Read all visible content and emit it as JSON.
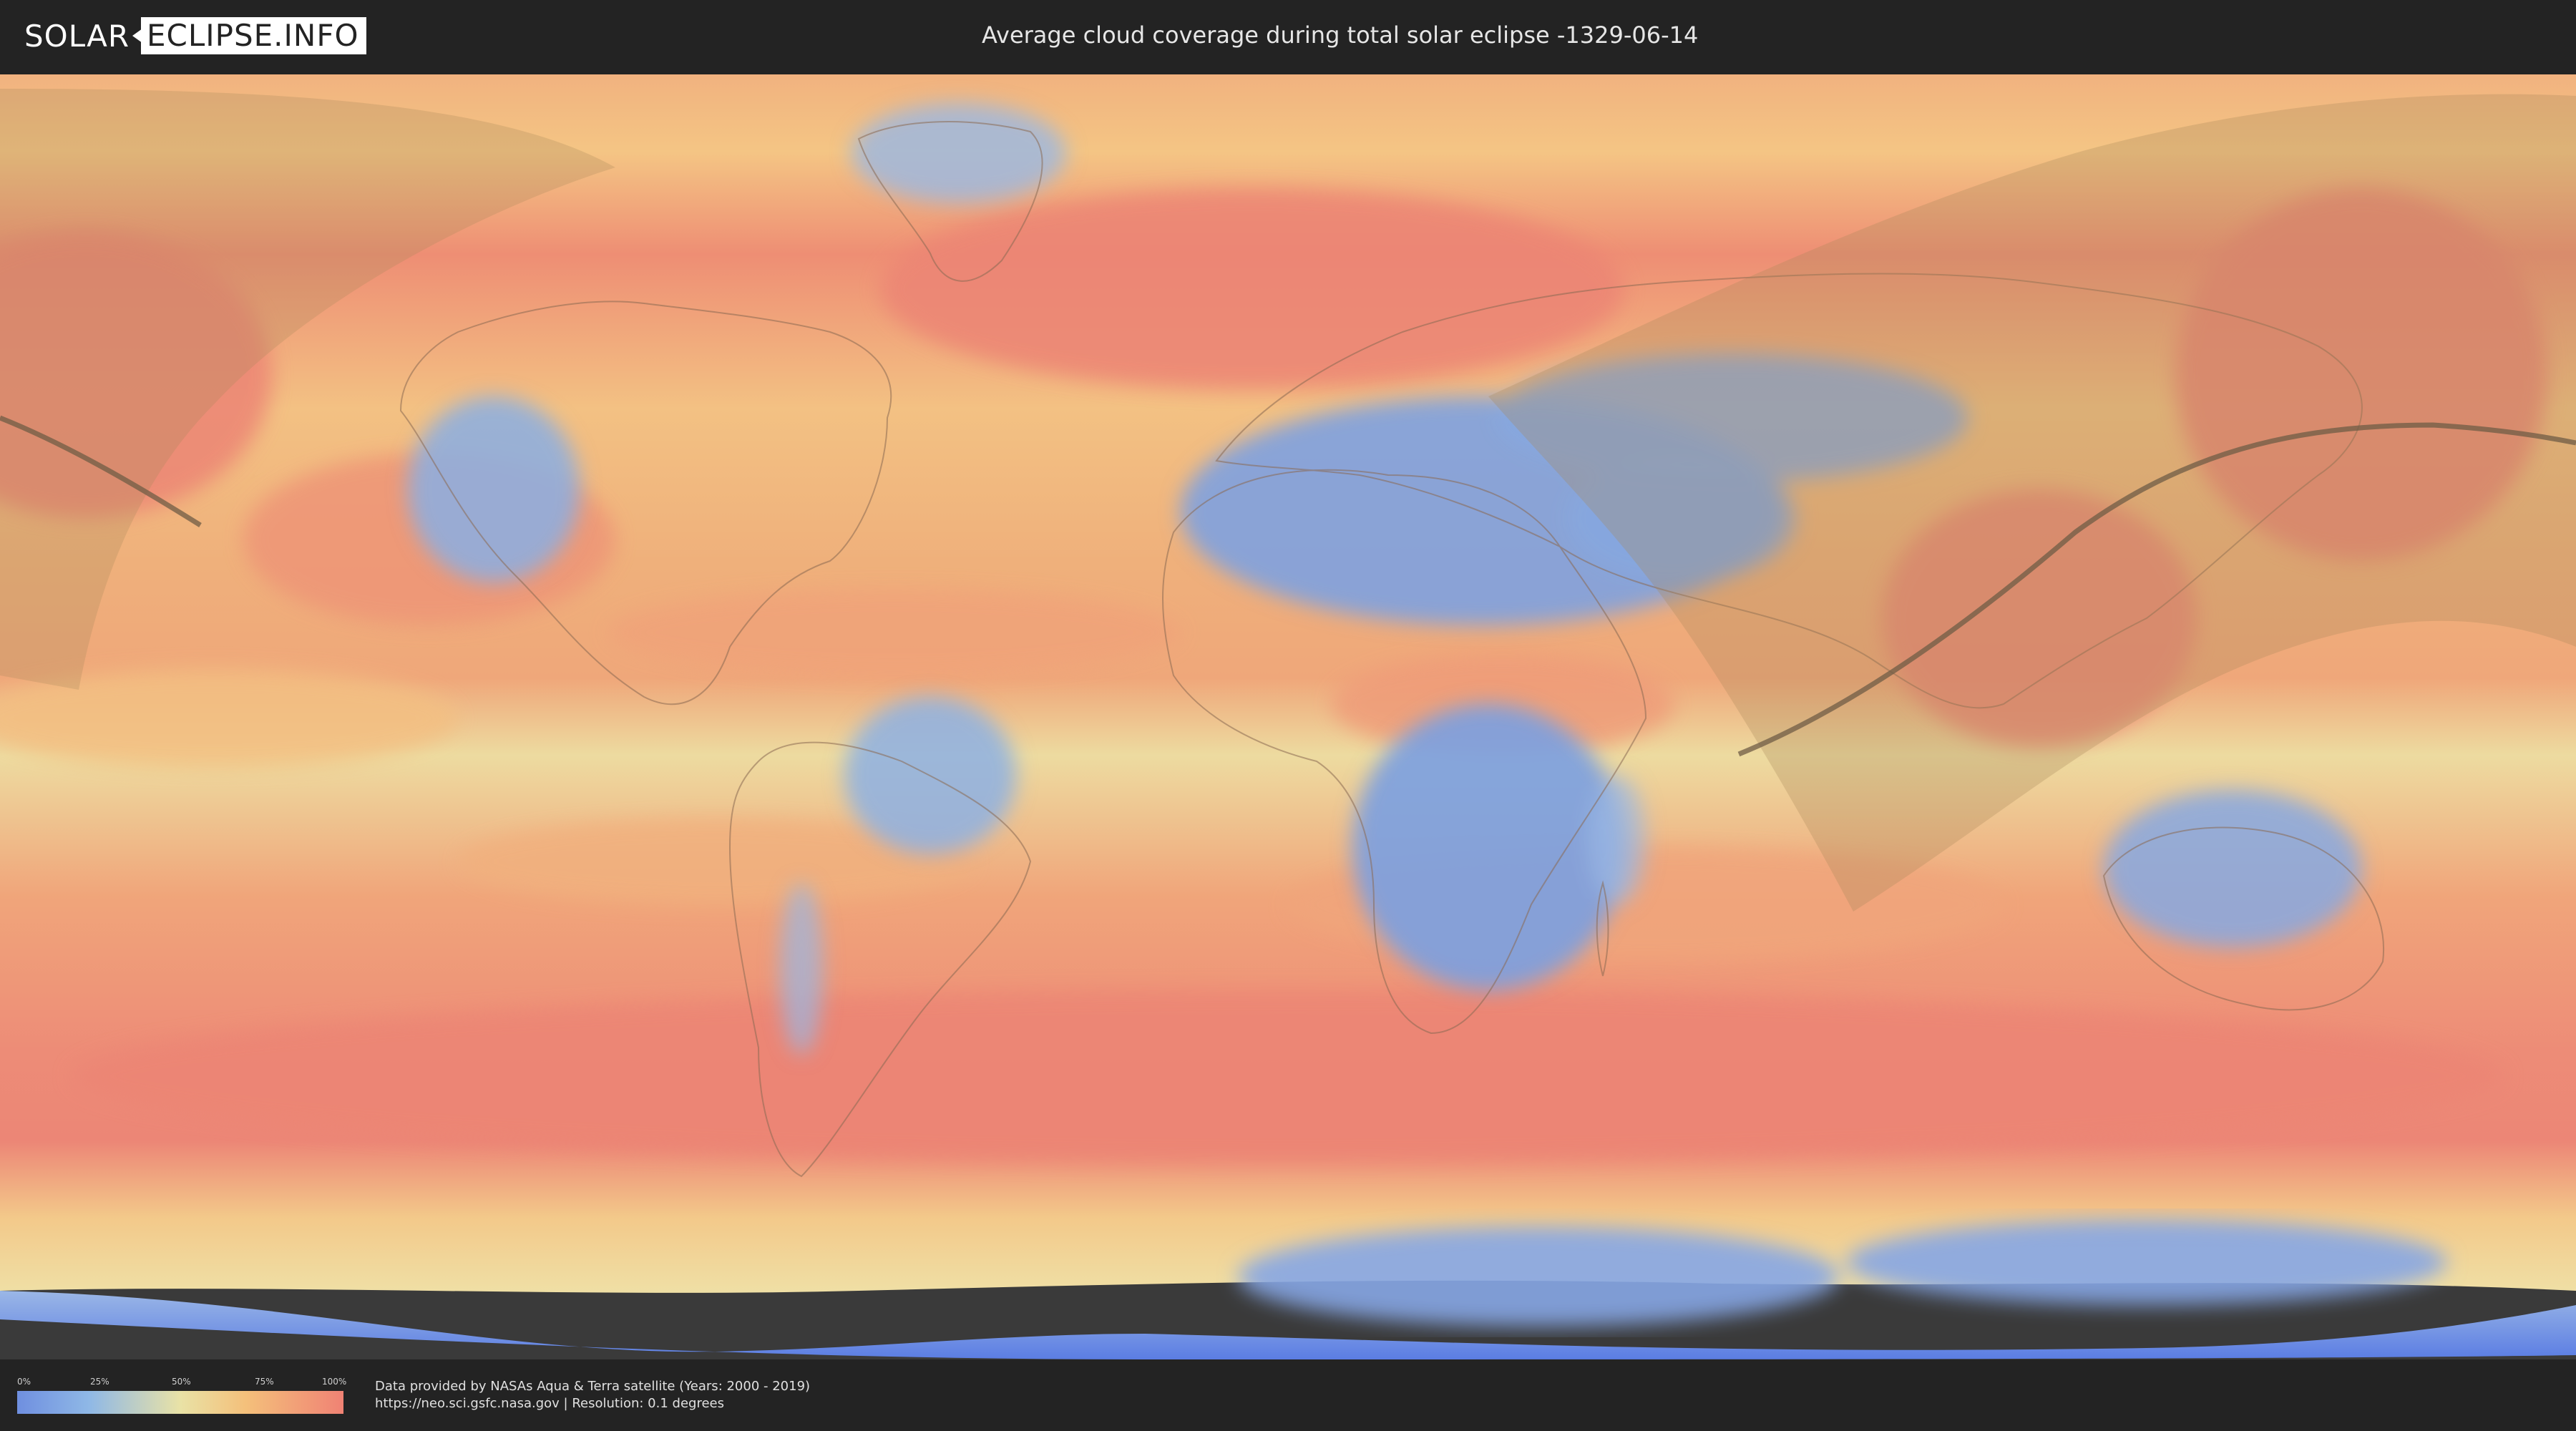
{
  "header": {
    "logo_solar": "SOLAR",
    "logo_eclipse": "ECLIPSE.INFO",
    "title": "Average cloud coverage during total solar eclipse -1329-06-14"
  },
  "legend": {
    "ticks": [
      "0%",
      "25%",
      "50%",
      "75%",
      "100%"
    ],
    "colors": {
      "low": "#6f8fe0",
      "mid": "#e9e2a6",
      "high": "#f08274"
    }
  },
  "footer": {
    "credit_line_1": "Data provided by NASAs Aqua & Terra satellite (Years: 2000 - 2019)",
    "credit_line_2": "https://neo.sci.gsfc.nasa.gov | Resolution: 0.1 degrees"
  },
  "map": {
    "colors": {
      "ocean_cloudy": "#ef8a72",
      "moderate": "#f3c884",
      "light": "#ecdca0",
      "clear": "#7ea3e2",
      "polar_clear": "#5d7fe2",
      "eclipse_overlay": "#a8875a",
      "eclipse_path": "#6f5c45",
      "border_lines": "#8a6a52"
    }
  }
}
